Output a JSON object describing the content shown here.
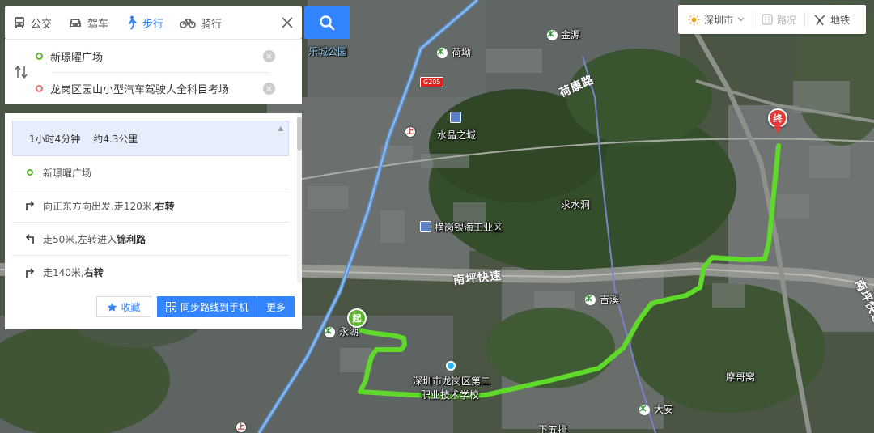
{
  "tabs": [
    {
      "label": "公交",
      "icon": "bus-icon",
      "active": false
    },
    {
      "label": "驾车",
      "icon": "car-icon",
      "active": false
    },
    {
      "label": "步行",
      "icon": "walk-icon",
      "active": true
    },
    {
      "label": "骑行",
      "icon": "bike-icon",
      "active": false
    }
  ],
  "route": {
    "start": "新璟曜广场",
    "end": "龙岗区园山小型汽车驾驶人全科目考场",
    "start_color": "#5cb531",
    "end_color": "#e57373"
  },
  "summary": {
    "duration": "1小时4分钟",
    "distance": "约4.3公里"
  },
  "steps": [
    {
      "kind": "origin",
      "parts": [
        "新璟曜广场"
      ]
    },
    {
      "kind": "turn-right",
      "parts": [
        "向正东方向出发,走120米,",
        "右转"
      ]
    },
    {
      "kind": "turn-left",
      "parts": [
        "走50米,左转进入",
        "锦利路"
      ]
    },
    {
      "kind": "turn-right",
      "parts": [
        "走140米,",
        "右转"
      ]
    }
  ],
  "actions": {
    "favorite": "收藏",
    "sync": "同步路线到手机",
    "more": "更多"
  },
  "toolbar": {
    "city": "深圳市",
    "traffic": "路况",
    "subway": "地铁"
  },
  "map": {
    "places": [
      {
        "text": "金源",
        "type": "metro"
      },
      {
        "text": "荷坳",
        "type": "metro"
      },
      {
        "text": "乐城公园",
        "type": "park"
      },
      {
        "text": "水晶之城",
        "type": "building"
      },
      {
        "text": "求水洞",
        "type": "area"
      },
      {
        "text": "横岗银海工业区",
        "type": "building"
      },
      {
        "text": "吉溪",
        "type": "metro"
      },
      {
        "text": "永湖",
        "type": "metro"
      },
      {
        "text": "深圳市龙岗区第二",
        "type": "school"
      },
      {
        "text": "职业技术学校",
        "type": "school"
      },
      {
        "text": "大安",
        "type": "metro"
      },
      {
        "text": "摩哥窝",
        "type": "area"
      },
      {
        "text": "下五排",
        "type": "area"
      }
    ],
    "roads": [
      "南坪快速",
      "南坪快速",
      "荷康路"
    ],
    "shield": "G205",
    "start_marker": "起",
    "end_marker": "终",
    "route_color": "#5fd92a"
  }
}
